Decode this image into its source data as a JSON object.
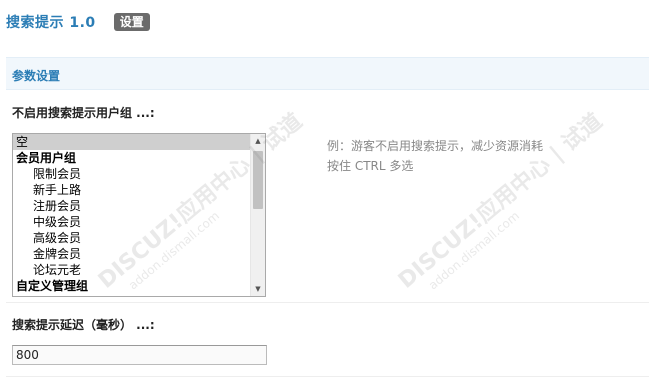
{
  "header": {
    "title": "搜索提示 1.0",
    "tag": "设置"
  },
  "section": {
    "title": "参数设置"
  },
  "usergroup_field": {
    "label": "不启用搜索提示用户组 ...:",
    "options": [
      {
        "label": "空",
        "type": "empty",
        "selected": true
      },
      {
        "label": "会员用户组",
        "type": "group"
      },
      {
        "label": "限制会员",
        "type": "sub"
      },
      {
        "label": "新手上路",
        "type": "sub"
      },
      {
        "label": "注册会员",
        "type": "sub"
      },
      {
        "label": "中级会员",
        "type": "sub"
      },
      {
        "label": "高级会员",
        "type": "sub"
      },
      {
        "label": "金牌会员",
        "type": "sub"
      },
      {
        "label": "论坛元老",
        "type": "sub"
      },
      {
        "label": "自定义管理组",
        "type": "group"
      }
    ],
    "hint_line1": "例：游客不启用搜索提示，减少资源消耗",
    "hint_line2": "按住 CTRL 多选"
  },
  "delay_field": {
    "label": "搜索提示延迟（毫秒） ...:",
    "value": "800"
  },
  "watermark": {
    "brand": "DISCUZ!应用中心",
    "tag": "试道",
    "site": "addon.dismall.com"
  }
}
